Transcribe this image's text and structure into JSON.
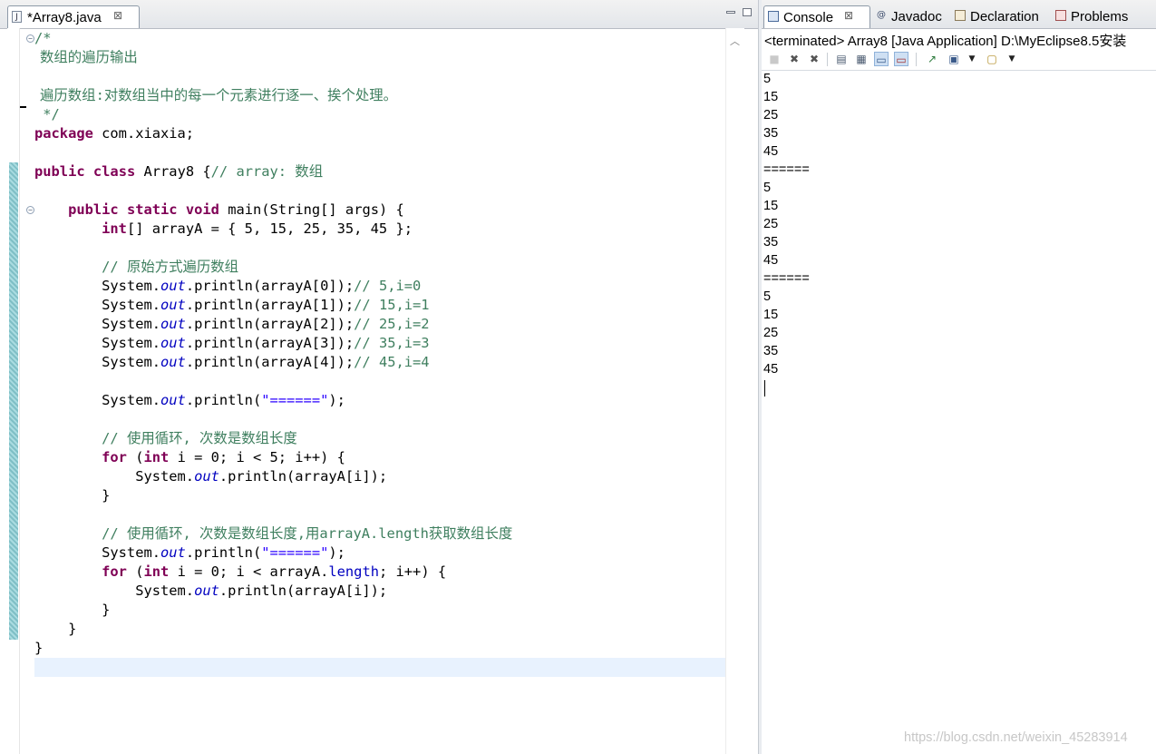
{
  "editor": {
    "tab_label": "*Array8.java",
    "tab_icon": "J",
    "tab_close": "⊠",
    "code_lines": [
      "/*",
      "数组的遍历输出",
      "",
      "遍历数组:对数组当中的每一个元素进行逐一、挨个处理。",
      " */",
      "package com.xiaxia;",
      "",
      "public class Array8 {// array: 数组",
      "",
      "    public static void main(String[] args) {",
      "        int[] arrayA = { 5, 15, 25, 35, 45 };",
      "",
      "        // 原始方式遍历数组",
      "        System.out.println(arrayA[0]);// 5,i=0",
      "        System.out.println(arrayA[1]);// 15,i=1",
      "        System.out.println(arrayA[2]);// 25,i=2",
      "        System.out.println(arrayA[3]);// 35,i=3",
      "        System.out.println(arrayA[4]);// 45,i=4",
      "",
      "        System.out.println(\"======\");",
      "",
      "        // 使用循环, 次数是数组长度",
      "        for (int i = 0; i < 5; i++) {",
      "            System.out.println(arrayA[i]);",
      "        }",
      "",
      "        // 使用循环, 次数是数组长度,用arrayA.length获取数组长度",
      "        System.out.println(\"======\");",
      "        for (int i = 0; i < arrayA.length; i++) {",
      "            System.out.println(arrayA[i]);",
      "        }",
      "    }",
      "}",
      ""
    ]
  },
  "console": {
    "tabs": [
      {
        "label": "Console",
        "icon": "console-icon",
        "active": true
      },
      {
        "label": "Javadoc",
        "icon": "javadoc-icon",
        "active": false
      },
      {
        "label": "Declaration",
        "icon": "declaration-icon",
        "active": false
      },
      {
        "label": "Problems",
        "icon": "problems-icon",
        "active": false
      }
    ],
    "status": "<terminated> Array8 [Java Application] D:\\MyEclipse8.5安装",
    "output": [
      "5",
      "15",
      "25",
      "35",
      "45",
      "======",
      "5",
      "15",
      "25",
      "35",
      "45",
      "======",
      "5",
      "15",
      "25",
      "35",
      "45"
    ]
  },
  "watermark": "https://blog.csdn.net/weixin_45283914",
  "colors": {
    "keyword": "#7f0055",
    "comment": "#3f7f5f",
    "field": "#0000c0",
    "string": "#2a00ff",
    "current_line": "#e8f2fe"
  }
}
